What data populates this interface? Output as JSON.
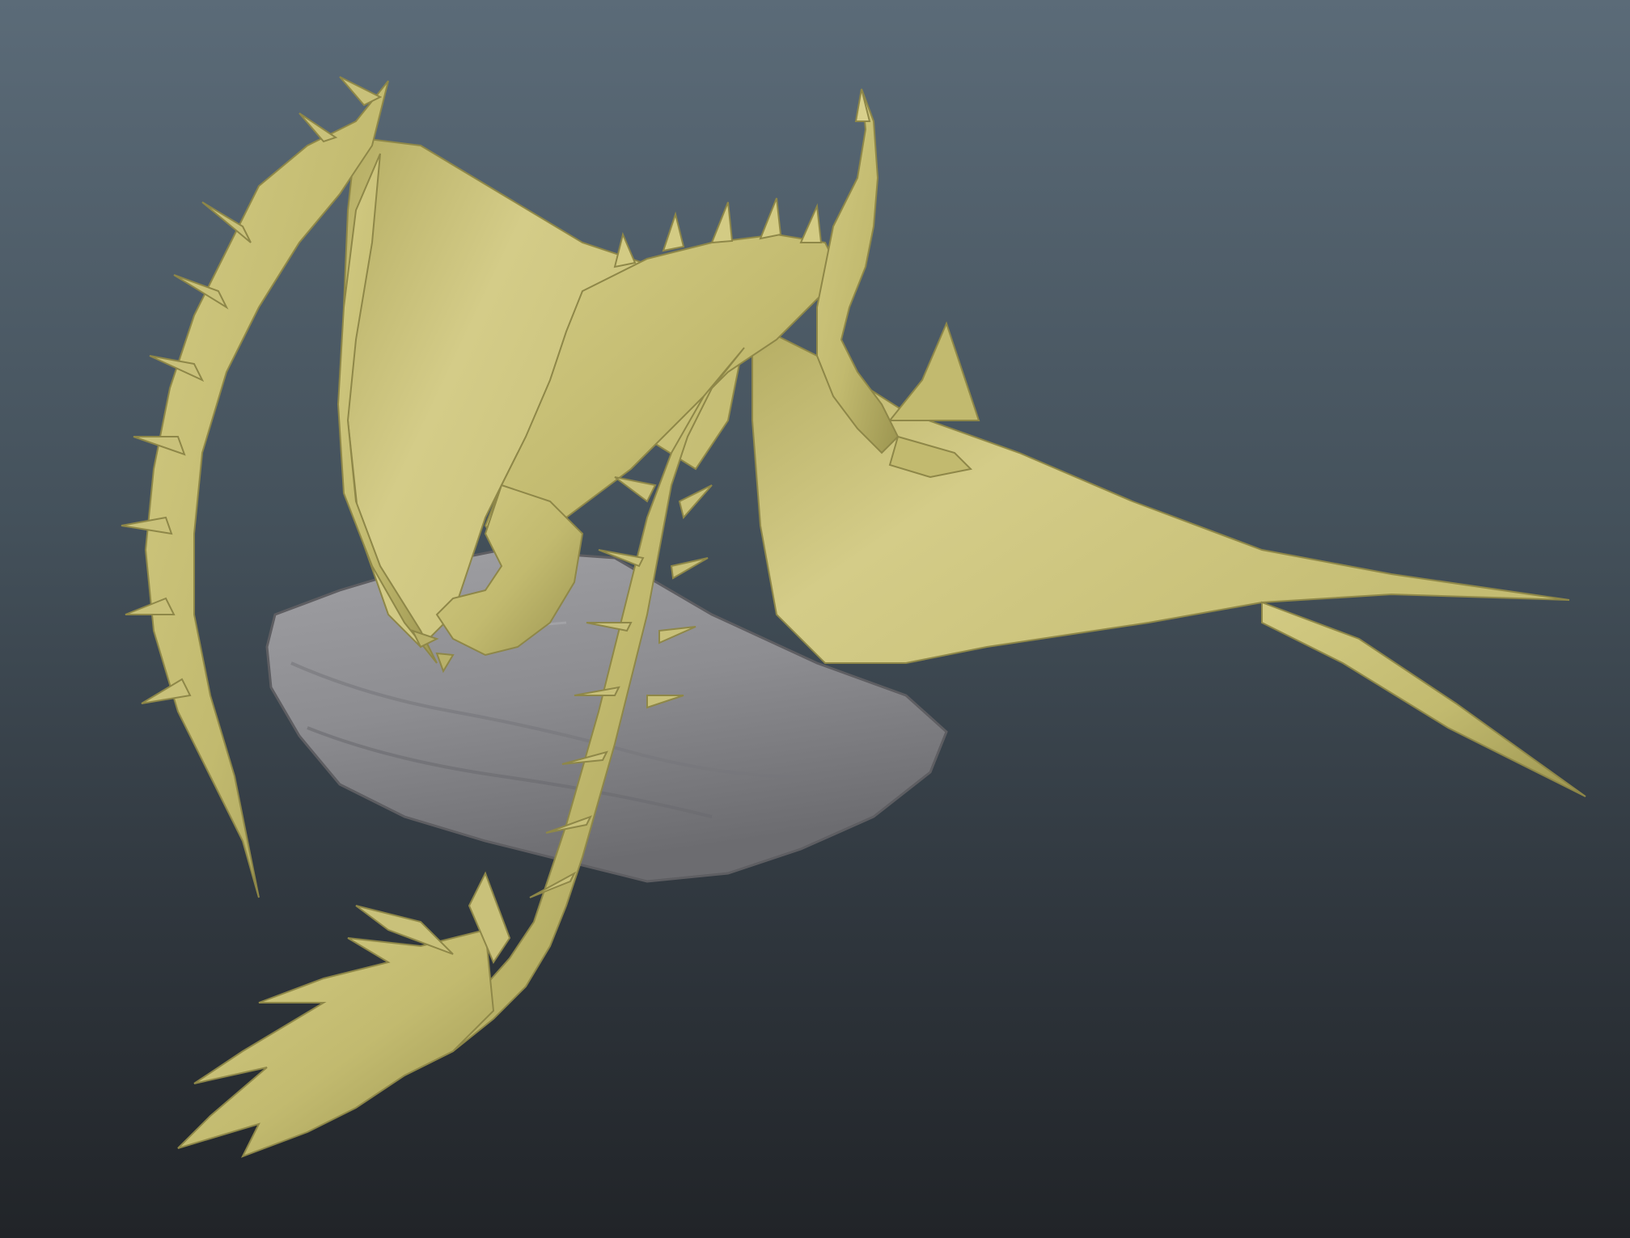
{
  "viewport": {
    "kind": "3d-sculpt-viewport",
    "background_top": "#5b6b78",
    "background_bottom": "#212428"
  },
  "scene": {
    "model_color": "#c8c077",
    "model_shadow_color": "#9c9550",
    "base_color": "#8f8f92",
    "base_shadow_color": "#6e6e72",
    "objects": [
      "dragon-sculpt",
      "rock-base"
    ]
  }
}
